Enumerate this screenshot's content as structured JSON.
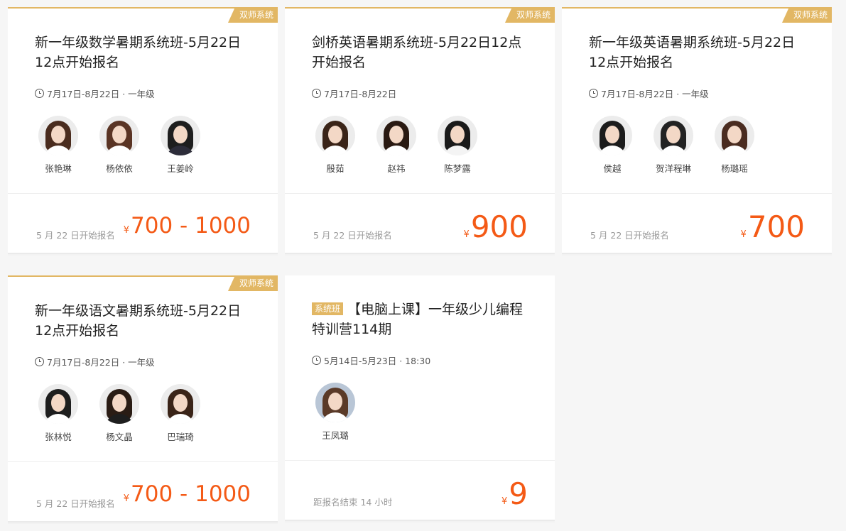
{
  "colors": {
    "accent": "#e2b764",
    "price": "#f45a16",
    "background": "#f6f6f6"
  },
  "courses": [
    {
      "tag": "双师系统",
      "title": "新一年级数学暑期系统班-5月22日12点开始报名",
      "meta": "7月17日-8月22日 · 一年级",
      "teachers": [
        {
          "name": "张艳琳",
          "hair": "#4a2c1e",
          "shirt": "#ffffff"
        },
        {
          "name": "杨依依",
          "hair": "#5a3424",
          "shirt": "#ffffff"
        },
        {
          "name": "王姜岭",
          "hair": "#1e1e1e",
          "shirt": "#2d2d3a"
        }
      ],
      "note": "5 月 22 日开始报名",
      "currency": "¥",
      "price": "700 - 1000",
      "price_style": "range"
    },
    {
      "tag": "双师系统",
      "title": "剑桥英语暑期系统班-5月22日12点开始报名",
      "meta": "7月17日-8月22日",
      "teachers": [
        {
          "name": "殷茹",
          "hair": "#3a2418",
          "shirt": "#ffffff"
        },
        {
          "name": "赵祎",
          "hair": "#2a1a12",
          "shirt": "#ffffff"
        },
        {
          "name": "陈梦露",
          "hair": "#1a1a1a",
          "shirt": "#f4f4f4"
        }
      ],
      "note": "5 月 22 日开始报名",
      "currency": "¥",
      "price": "900",
      "price_style": "single"
    },
    {
      "tag": "双师系统",
      "title": "新一年级英语暑期系统班-5月22日12点开始报名",
      "meta": "7月17日-8月22日 · 一年级",
      "teachers": [
        {
          "name": "侯越",
          "hair": "#1c1c1c",
          "shirt": "#ffffff"
        },
        {
          "name": "贺洋程琳",
          "hair": "#222222",
          "shirt": "#ffffff"
        },
        {
          "name": "杨璐瑶",
          "hair": "#4a2c20",
          "shirt": "#ffffff"
        }
      ],
      "note": "5 月 22 日开始报名",
      "currency": "¥",
      "price": "700",
      "price_style": "single"
    },
    {
      "tag": "双师系统",
      "title": "新一年级语文暑期系统班-5月22日12点开始报名",
      "meta": "7月17日-8月22日 · 一年级",
      "teachers": [
        {
          "name": "张林悦",
          "hair": "#1e1e1e",
          "shirt": "#ffffff"
        },
        {
          "name": "杨文晶",
          "hair": "#2a1c14",
          "shirt": "#1e1e1e"
        },
        {
          "name": "巴瑞琦",
          "hair": "#3a2418",
          "shirt": "#ffffff"
        }
      ],
      "note": "5 月 22 日开始报名",
      "currency": "¥",
      "price": "700 - 1000",
      "price_style": "range"
    },
    {
      "tag": "",
      "badge": "系统班",
      "title": "【电脑上课】一年级少儿编程特训营114期",
      "meta": "5月14日-5月23日 · 18:30",
      "teachers": [
        {
          "name": "王凤璐",
          "hair": "#5a3a28",
          "shirt": "#ffffff"
        }
      ],
      "note": "距报名结束 14 小时",
      "currency": "¥",
      "price": "9",
      "price_style": "single"
    }
  ]
}
